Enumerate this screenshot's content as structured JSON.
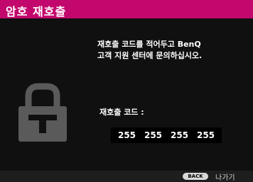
{
  "dialog": {
    "title": "암호 재호출",
    "message_line1": "재호출 코드를 적어두고 BenQ",
    "message_line2": "고객 지원 센터에 문의하십시오.",
    "code_label": "재호출 코드 :",
    "code_values": [
      "255",
      "255",
      "255",
      "255"
    ]
  },
  "footer": {
    "back_key": "BACK",
    "back_label": "나가기"
  },
  "icons": {
    "lock": "lock-icon"
  },
  "colors": {
    "title_bar": "#c2086c",
    "background": "#101010",
    "lock_icon": "#5a5a5a"
  }
}
